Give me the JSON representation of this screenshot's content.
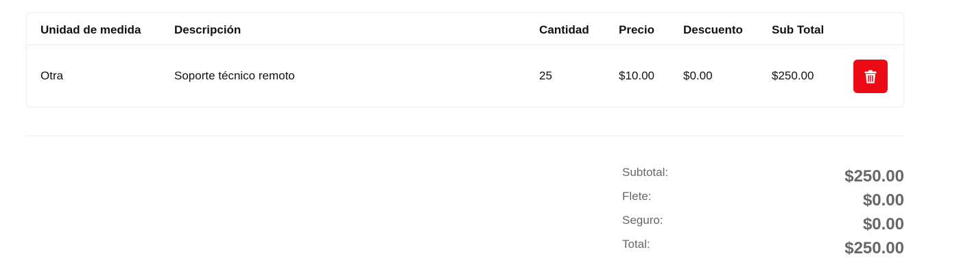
{
  "table": {
    "headers": {
      "unit": "Unidad de medida",
      "description": "Descripción",
      "quantity": "Cantidad",
      "price": "Precio",
      "discount": "Descuento",
      "subtotal": "Sub Total"
    },
    "rows": [
      {
        "unit": "Otra",
        "description": "Soporte técnico remoto",
        "quantity": "25",
        "price": "$10.00",
        "discount": "$0.00",
        "subtotal": "$250.00",
        "delete_icon": "trash-icon"
      }
    ]
  },
  "totals": {
    "subtotal_label": "Subtotal:",
    "subtotal_value": "$250.00",
    "freight_label": "Flete:",
    "freight_value": "$0.00",
    "insurance_label": "Seguro:",
    "insurance_value": "$0.00",
    "total_label": "Total:",
    "total_value": "$250.00"
  },
  "colors": {
    "delete_button": "#ee0a14",
    "totals_text": "#666666"
  }
}
